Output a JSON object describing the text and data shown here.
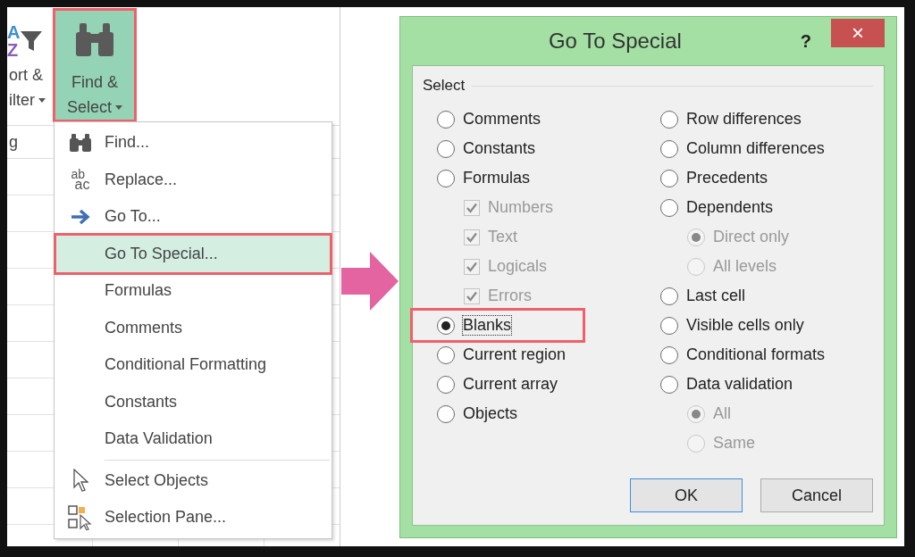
{
  "ribbon": {
    "sort_filter": {
      "icon_letters": [
        "A",
        "Z"
      ],
      "line1": "ort &",
      "line2": "ilter",
      "group_label": "g"
    },
    "find_select": {
      "line1": "Find &",
      "line2": "Select",
      "selected": true,
      "highlighted": true
    }
  },
  "menu": {
    "groups": [
      [
        {
          "label": "Find...",
          "kind": "find",
          "selected": false,
          "highlighted": false
        },
        {
          "label": "Replace...",
          "kind": "replace",
          "icon_text": [
            "ab",
            "ac"
          ],
          "selected": false,
          "highlighted": false
        },
        {
          "label": "Go To...",
          "kind": "goto",
          "selected": false,
          "highlighted": false
        },
        {
          "label": "Go To Special...",
          "selected": true,
          "highlighted": true
        },
        {
          "label": "Formulas",
          "selected": false,
          "highlighted": false
        },
        {
          "label": "Comments",
          "selected": false,
          "highlighted": false
        },
        {
          "label": "Conditional Formatting",
          "selected": false,
          "highlighted": false
        },
        {
          "label": "Constants",
          "selected": false,
          "highlighted": false
        },
        {
          "label": "Data Validation",
          "selected": false,
          "highlighted": false
        }
      ],
      [
        {
          "label": "Select Objects",
          "kind": "select-objects",
          "selected": false,
          "highlighted": false
        },
        {
          "label": "Selection Pane...",
          "kind": "selection-pane",
          "selected": false,
          "highlighted": false
        }
      ]
    ]
  },
  "dialog": {
    "title": "Go To Special",
    "help": "?",
    "close": "×",
    "group_label": "Select",
    "columns": [
      [
        {
          "label": "Comments",
          "kind": "radio",
          "selected": false,
          "disabled": false,
          "focused": false
        },
        {
          "label": "Constants",
          "kind": "radio",
          "selected": false,
          "disabled": false,
          "focused": false
        },
        {
          "label": "Formulas",
          "kind": "radio",
          "selected": false,
          "disabled": false,
          "focused": false,
          "children": [
            {
              "label": "Numbers",
              "kind": "checkbox",
              "checked": true,
              "disabled": true
            },
            {
              "label": "Text",
              "kind": "checkbox",
              "checked": true,
              "disabled": true
            },
            {
              "label": "Logicals",
              "kind": "checkbox",
              "checked": true,
              "disabled": true
            },
            {
              "label": "Errors",
              "kind": "checkbox",
              "checked": true,
              "disabled": true
            }
          ]
        },
        {
          "label": "Blanks",
          "kind": "radio",
          "selected": true,
          "disabled": false,
          "highlighted": true,
          "focused": true
        },
        {
          "label": "Current region",
          "kind": "radio",
          "selected": false,
          "disabled": false,
          "focused": false
        },
        {
          "label": "Current array",
          "kind": "radio",
          "selected": false,
          "disabled": false,
          "focused": false
        },
        {
          "label": "Objects",
          "kind": "radio",
          "selected": false,
          "disabled": false,
          "focused": false
        }
      ],
      [
        {
          "label": "Row differences",
          "kind": "radio",
          "selected": false,
          "disabled": false,
          "focused": false
        },
        {
          "label": "Column differences",
          "kind": "radio",
          "selected": false,
          "disabled": false,
          "focused": false
        },
        {
          "label": "Precedents",
          "kind": "radio",
          "selected": false,
          "disabled": false,
          "focused": false
        },
        {
          "label": "Dependents",
          "kind": "radio",
          "selected": false,
          "disabled": false,
          "focused": false,
          "children": [
            {
              "label": "Direct only",
              "kind": "radio",
              "selected": true,
              "disabled": true
            },
            {
              "label": "All levels",
              "kind": "radio",
              "selected": false,
              "disabled": true
            }
          ]
        },
        {
          "label": "Last cell",
          "kind": "radio",
          "selected": false,
          "disabled": false,
          "focused": false
        },
        {
          "label": "Visible cells only",
          "kind": "radio",
          "selected": false,
          "disabled": false,
          "focused": false
        },
        {
          "label": "Conditional formats",
          "kind": "radio",
          "selected": false,
          "disabled": false,
          "focused": false
        },
        {
          "label": "Data validation",
          "kind": "radio",
          "selected": false,
          "disabled": false,
          "focused": false,
          "children": [
            {
              "label": "All",
              "kind": "radio",
              "selected": true,
              "disabled": true
            },
            {
              "label": "Same",
              "kind": "radio",
              "selected": false,
              "disabled": true
            }
          ]
        }
      ]
    ],
    "buttons": [
      {
        "label": "OK",
        "default": true
      },
      {
        "label": "Cancel",
        "default": false
      }
    ]
  }
}
